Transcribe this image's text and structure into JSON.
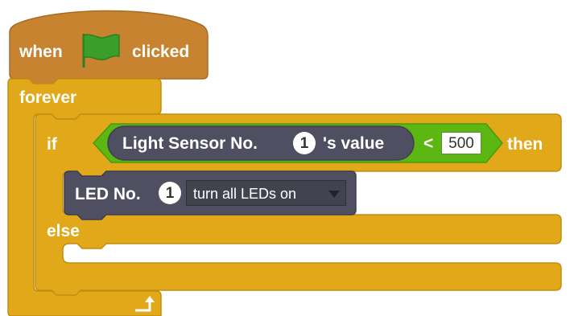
{
  "colors": {
    "events": "#C88330",
    "control": "#E1A91A",
    "operators": "#5CB712",
    "sensor": "#4F4F61",
    "flag": "#3A9F2A"
  },
  "hat_block": {
    "when_label": "when",
    "flag_icon": "green-flag-icon",
    "clicked_label": "clicked"
  },
  "forever_block": {
    "label": "forever",
    "arrow_icon": "loop-arrow-icon"
  },
  "if_block": {
    "if_label": "if",
    "then_label": "then",
    "else_label": "else",
    "condition": {
      "reporter_part1": "Light  Sensor  No.",
      "sensor_number": "1",
      "reporter_part2": "'s  value",
      "operator": "<",
      "compare_value": "500"
    }
  },
  "led_block": {
    "label": "LED  No.",
    "led_number": "1",
    "dropdown_value": "turn all LEDs on",
    "dropdown_icon": "dropdown-arrow-icon"
  }
}
